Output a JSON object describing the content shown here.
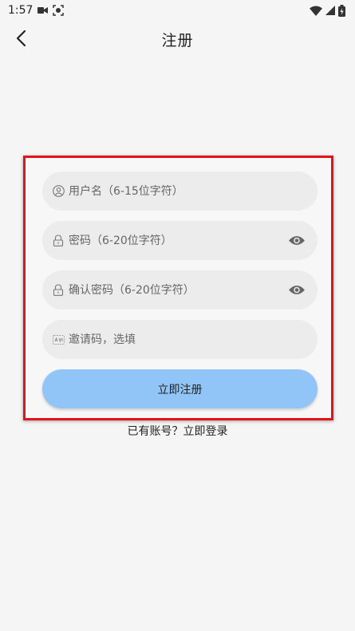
{
  "status_bar": {
    "time": "1:57",
    "icons": [
      "video-camera-icon",
      "screen-record-icon",
      "wifi-icon",
      "signal-icon",
      "battery-charging-icon"
    ]
  },
  "header": {
    "title": "注册",
    "back_icon": "chevron-left-icon"
  },
  "form": {
    "username": {
      "placeholder": "用户名（6-15位字符）",
      "value": "",
      "icon": "user-icon"
    },
    "password": {
      "placeholder": "密码（6-20位字符）",
      "value": "",
      "icon": "lock-icon",
      "toggle_icon": "eye-icon"
    },
    "confirm_password": {
      "placeholder": "确认密码（6-20位字符）",
      "value": "",
      "icon": "lock-icon",
      "toggle_icon": "eye-icon"
    },
    "invite_code": {
      "placeholder": "邀请码，选填",
      "value": "",
      "icon": "invite-code-icon"
    },
    "submit_label": "立即注册"
  },
  "footer": {
    "login_link": "已有账号？立即登录"
  },
  "colors": {
    "background": "#f5f5f5",
    "field_background": "#ececec",
    "submit_button": "#92c5f7",
    "highlight_frame": "#e4121a"
  }
}
